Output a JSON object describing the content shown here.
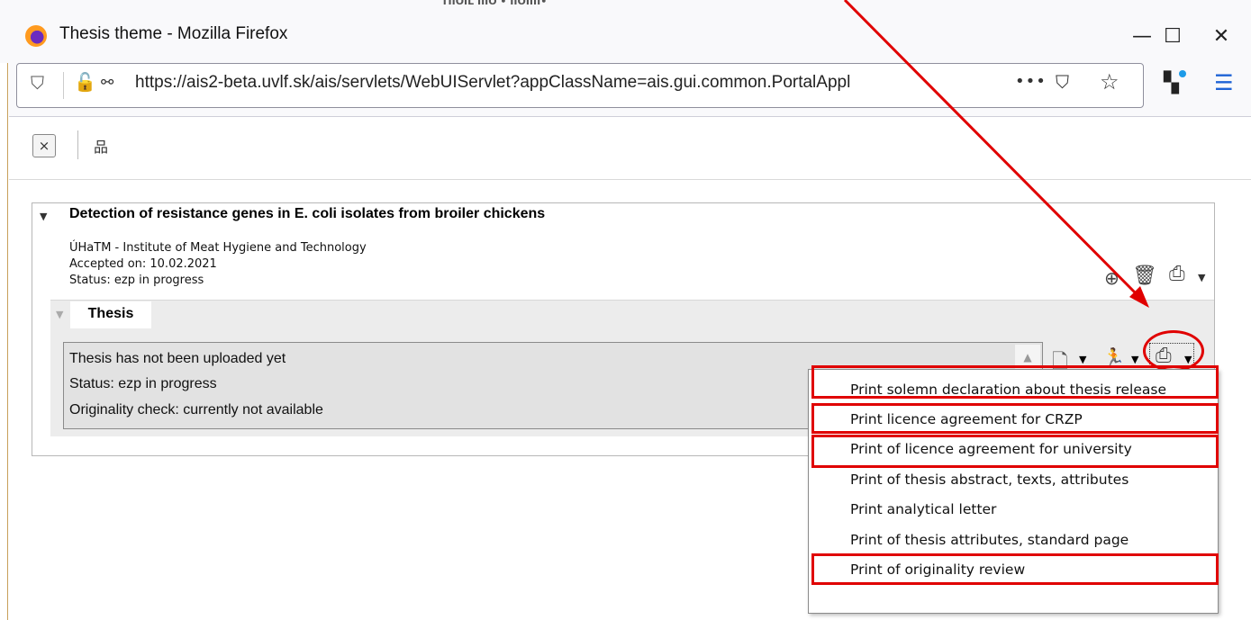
{
  "window": {
    "title": "Thesis theme - Mozilla Firefox",
    "minimize": "—",
    "maximize": "☐",
    "close": "✕",
    "top_fragment": "TIIOIL IIIO • IIOIIII•"
  },
  "address_bar": {
    "url": "https://ais2-beta.uvlf.sk/ais/servlets/WebUIServlet?appClassName=ais.gui.common.PortalAppl",
    "icons": [
      "shield-icon",
      "lock-warning-icon",
      "permissions-icon",
      "more-dots-icon",
      "pocket-icon",
      "star-icon",
      "extension-icon",
      "menu-icon"
    ]
  },
  "toolbar": {
    "close_glyph": "×",
    "tree_glyph": "品"
  },
  "thesis": {
    "title": "Detection of resistance genes in E. coli isolates from broiler chickens",
    "institute": "ÚHaTM - Institute of Meat Hygiene and Technology",
    "accepted": "Accepted on: 10.02.2021",
    "status": "Status: ezp in progress"
  },
  "subpanel": {
    "tab_label": "Thesis",
    "lines": [
      "Thesis has not been uploaded yet",
      "Status: ezp in progress",
      "Originality check: currently not available"
    ]
  },
  "print_menu": {
    "items": [
      "Print solemn declaration about thesis release",
      "Print licence agreement for CRZP",
      "Print of licence agreement for university",
      "Print of thesis abstract, texts, attributes",
      "Print analytical letter",
      "Print of thesis attributes, standard page",
      "Print of originality review"
    ]
  },
  "colors": {
    "annotation_red": "#e00000",
    "firefox_menu_blue": "#1e63d6"
  }
}
